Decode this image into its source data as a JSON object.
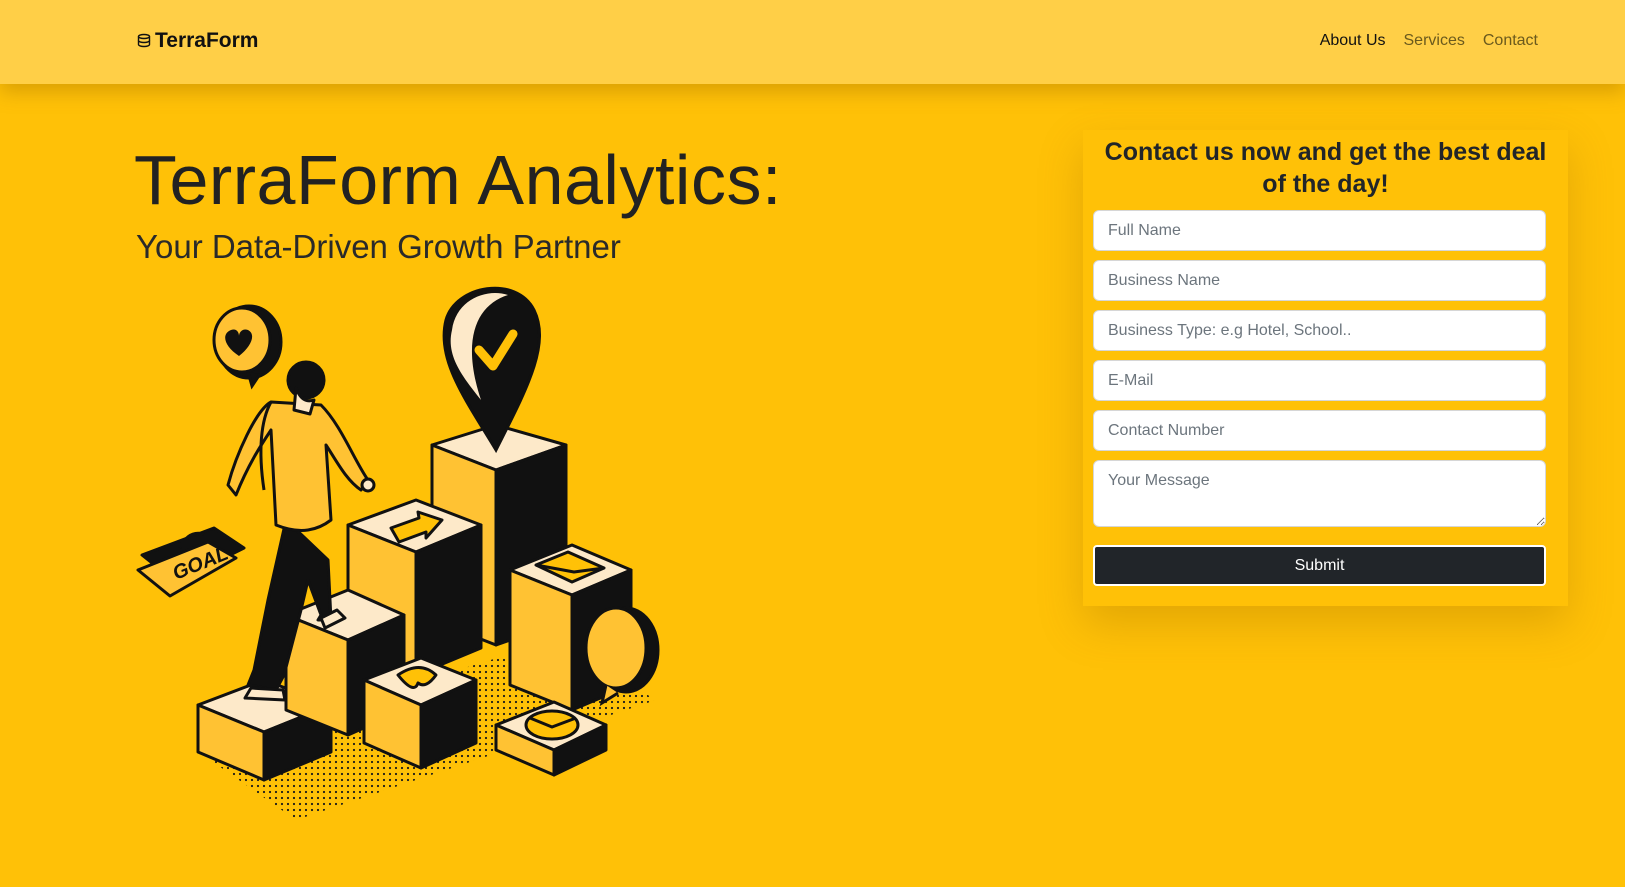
{
  "nav": {
    "brand": "TerraForm",
    "links": [
      "About Us",
      "Services",
      "Contact"
    ],
    "active_link": "About Us"
  },
  "hero": {
    "title": "TerraForm Analytics:",
    "subtitle": "Your Data-Driven Growth Partner",
    "illustration_label": "GOAL"
  },
  "form": {
    "heading": "Contact us now and get the best deal of the day!",
    "fields": {
      "full_name": "Full Name",
      "business_name": "Business Name",
      "business_type": "Business Type: e.g Hotel, School..",
      "email": "E-Mail",
      "contact_number": "Contact Number",
      "message": "Your Message"
    },
    "submit_label": "Submit"
  },
  "colors": {
    "background": "#FFC107",
    "navbar": "#FFCF47",
    "dark": "#212529",
    "cream": "#FDE9C9"
  }
}
